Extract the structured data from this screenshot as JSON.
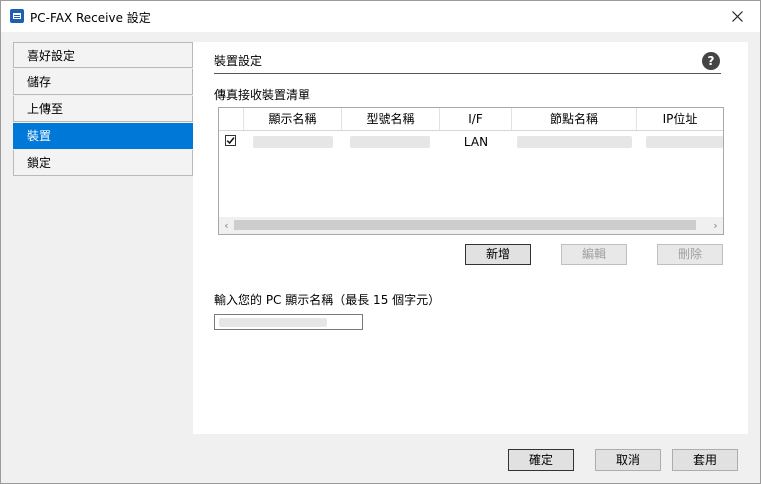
{
  "window": {
    "title": "PC-FAX Receive 設定"
  },
  "sidebar": {
    "items": [
      {
        "label": "喜好設定"
      },
      {
        "label": "儲存"
      },
      {
        "label": "上傳至"
      },
      {
        "label": "裝置",
        "active": true
      },
      {
        "label": "鎖定"
      }
    ]
  },
  "panel": {
    "title": "裝置設定",
    "help": "?",
    "list_label": "傳真接收裝置清單",
    "columns": [
      "顯示名稱",
      "型號名稱",
      "I/F",
      "節點名稱",
      "IP位址"
    ],
    "rows": [
      {
        "checked": true,
        "interface": "LAN"
      }
    ],
    "buttons": {
      "add": "新增",
      "edit": "編輯",
      "delete": "刪除"
    },
    "name_label": "輸入您的 PC 顯示名稱（最長 15 個字元）"
  },
  "footer": {
    "ok": "確定",
    "cancel": "取消",
    "apply": "套用"
  },
  "colors": {
    "accent": "#0078d7"
  }
}
